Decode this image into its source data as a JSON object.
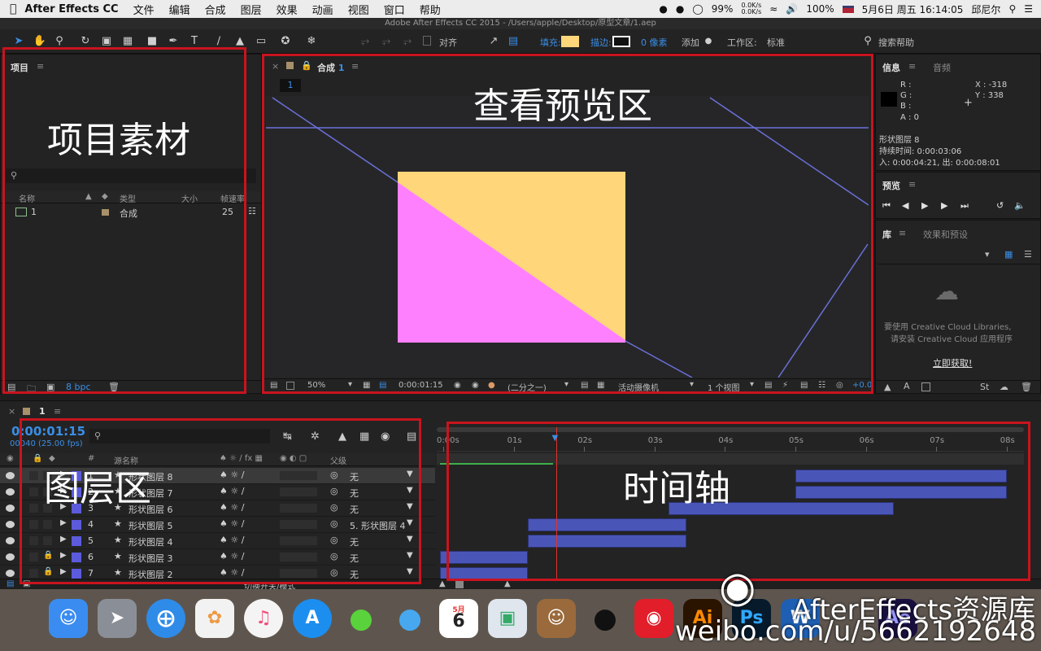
{
  "menubar": {
    "app": "After Effects CC",
    "items": [
      "文件",
      "编辑",
      "合成",
      "图层",
      "效果",
      "动画",
      "视图",
      "窗口",
      "帮助"
    ],
    "battery_pct": "99%",
    "net_up": "0.0K/s",
    "net_down": "0.0K/s",
    "battery2": "100%",
    "datetime": "5月6日 周五  16:14:05",
    "user": "邱尼尔"
  },
  "titlebar": "Adobe After Effects CC 2015 - /Users/apple/Desktop/原型文章/1.aep",
  "toolbar": {
    "align": "对齐",
    "fill": "填充:",
    "fill_color": "#ffd67a",
    "stroke": "描边:",
    "stroke_px": "0 像素",
    "add": "添加",
    "workspace_label": "工作区:",
    "workspace": "标准",
    "search_help": "搜索帮助"
  },
  "project": {
    "tab": "项目",
    "columns": [
      "名称",
      "类型",
      "大小",
      "帧速率"
    ],
    "items": [
      {
        "name": "1",
        "type": "合成",
        "rate": "25"
      }
    ],
    "bpc": "8 bpc"
  },
  "comp": {
    "tab": "合成",
    "tab_num": "1",
    "crumb": "1",
    "zoom": "50%",
    "timecode": "0:00:01:15",
    "resolution": "(二分之一)",
    "camera": "活动摄像机",
    "views": "1 个视图",
    "exposure": "+0.0"
  },
  "info": {
    "tab": "信息",
    "tab2": "音频",
    "r": "R :",
    "g": "G :",
    "b": "B :",
    "a": "A : 0",
    "x": "X : -318",
    "y": "Y : 338",
    "layer": "形状图层 8",
    "duration": "持续时间: 0:00:03:06",
    "inout": "入: 0:00:04:21,  出: 0:00:08:01"
  },
  "preview": {
    "tab": "预览"
  },
  "library": {
    "tab": "库",
    "tab2": "效果和预设",
    "msg1": "要使用 Creative Cloud Libraries,",
    "msg2": "请安装 Creative Cloud 应用程序",
    "cta": "立即获取!"
  },
  "timeline": {
    "tab": "1",
    "timecode": "0:00:01:15",
    "frames": "00040 (25.00 fps)",
    "col_name": "源名称",
    "col_parent": "父级",
    "toggle": "切换开关/模式",
    "ticks": [
      "0:00s",
      "01s",
      "02s",
      "03s",
      "04s",
      "05s",
      "06s",
      "07s",
      "08s"
    ],
    "layers": [
      {
        "num": "1",
        "name": "形状图层 8",
        "parent": "无",
        "locked": false
      },
      {
        "num": "2",
        "name": "形状图层 7",
        "parent": "无",
        "locked": false
      },
      {
        "num": "3",
        "name": "形状图层 6",
        "parent": "无",
        "locked": false
      },
      {
        "num": "4",
        "name": "形状图层 5",
        "parent": "5. 形状图层 4",
        "locked": false
      },
      {
        "num": "5",
        "name": "形状图层 4",
        "parent": "无",
        "locked": false
      },
      {
        "num": "6",
        "name": "形状图层 3",
        "parent": "无",
        "locked": true
      },
      {
        "num": "7",
        "name": "形状图层 2",
        "parent": "无",
        "locked": true
      }
    ],
    "layer_spans_sec": [
      [
        5.0,
        8.0
      ],
      [
        5.0,
        8.0
      ],
      [
        3.2,
        6.4
      ],
      [
        1.2,
        3.45
      ],
      [
        1.2,
        3.45
      ],
      [
        -0.1,
        1.2
      ],
      [
        -0.1,
        1.2
      ]
    ],
    "playhead_sec": 1.6
  },
  "annotations": {
    "project": "项目素材",
    "viewer": "查看预览区",
    "layers": "图层区",
    "timeline": "时间轴"
  },
  "dock": {
    "calendar_month": "5月",
    "calendar_day": "6"
  },
  "watermark": {
    "line1": "AfterEffects资源库",
    "line2": "weibo.com/u/5662192648"
  },
  "colors": {
    "accent_blue": "#3a8ee6",
    "shape_yellow": "#ffd67a",
    "shape_pink": "#ff80ff",
    "layer_bar": "#4a55b8",
    "red_frame": "#c8141e"
  }
}
